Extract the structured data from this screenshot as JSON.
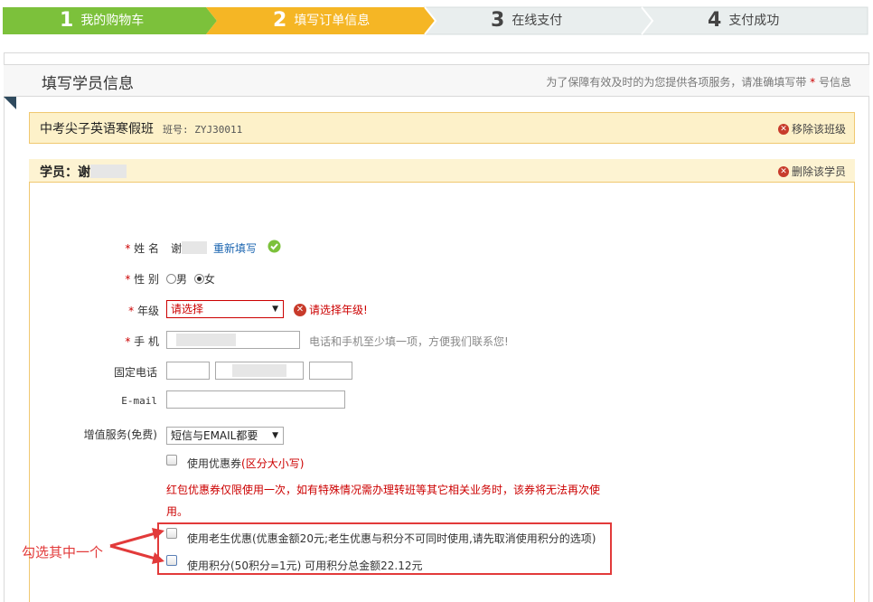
{
  "steps": [
    {
      "num": "1",
      "label": "我的购物车"
    },
    {
      "num": "2",
      "label": "填写订单信息"
    },
    {
      "num": "3",
      "label": "在线支付"
    },
    {
      "num": "4",
      "label": "支付成功"
    }
  ],
  "section": {
    "title": "填写学员信息",
    "note_before": "为了保障有效及时的为您提供各项服务，请准确填写带 ",
    "note_star": "*",
    "note_after": " 号信息"
  },
  "class_bar": {
    "name": "中考尖子英语寒假班",
    "no": "班号: ZYJ30011",
    "remove": "移除该班级"
  },
  "student": {
    "title": "学员：谢",
    "delete": "删除该学员"
  },
  "form": {
    "name_label": "姓 名",
    "name_value": "谢",
    "refill": "重新填写",
    "gender_label": "性 别",
    "gender_male": "男",
    "gender_female": "女",
    "gender_selected": "女",
    "grade_label": "年级",
    "grade_value": "请选择",
    "grade_error": "请选择年级!",
    "mobile_label": "手 机",
    "mobile_hint": "电话和手机至少填一项，方便我们联系您!",
    "phone_label": "固定电话",
    "email_label": "E-mail",
    "service_label": "增值服务(免费)",
    "service_value": "短信与EMAIL都要",
    "coupon_label": "使用优惠券",
    "coupon_note": "(区分大小写)",
    "red_notice_1": "红包优惠券仅限使用一次，如有特殊情况需办理转班等其它相关业务时，该券将无法再次使",
    "red_notice_2": "用。",
    "old_student": "使用老生优惠(优惠金额20元;老生优惠与积分不可同时使用,请先取消使用积分的选项)",
    "points": "使用积分(50积分=1元) 可用积分总金额22.12元"
  },
  "annotation": "勾选其中一个",
  "colors": {
    "step1": "#7cc13b",
    "step2": "#f5b625",
    "step_inactive": "#e9eeee",
    "error": "#cc0000",
    "highlight": "#e23a3a"
  }
}
